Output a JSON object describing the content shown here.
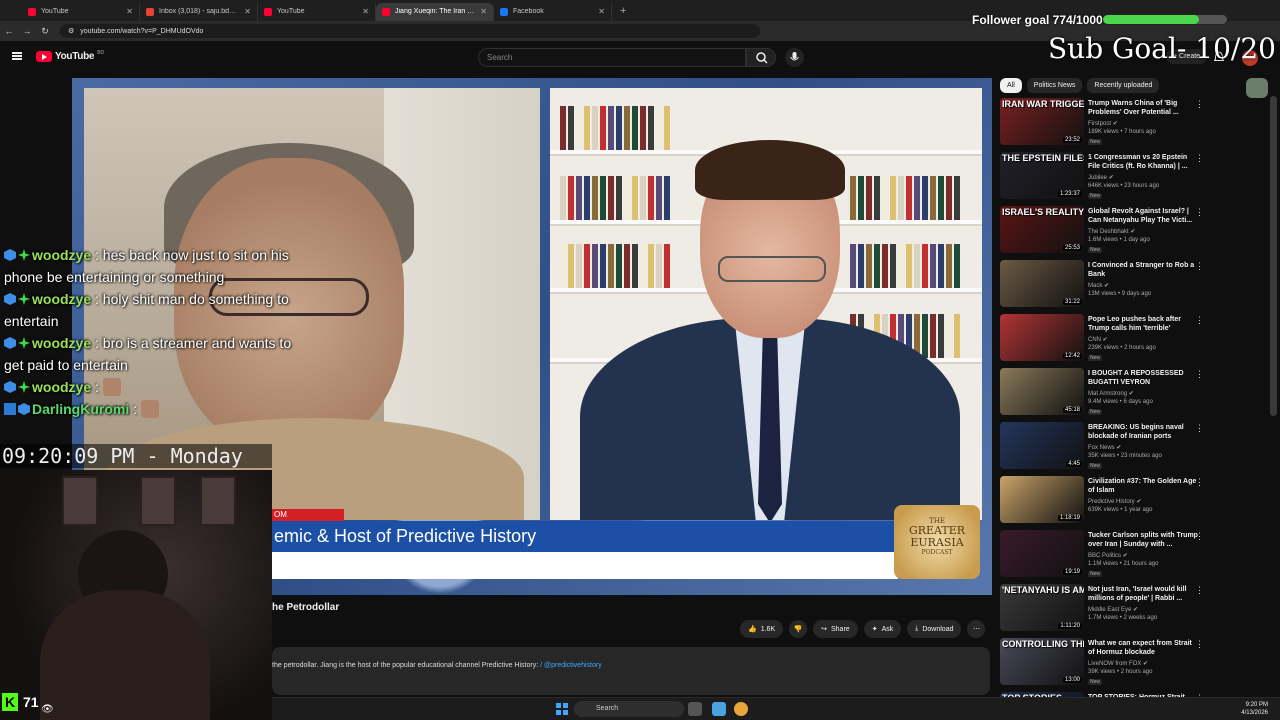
{
  "browser": {
    "tabs": [
      {
        "title": "YouTube",
        "color": "#ff0033"
      },
      {
        "title": "Inbox (3,018) - saju.bd113@gm",
        "color": "#ea4335"
      },
      {
        "title": "YouTube",
        "color": "#ff0033"
      },
      {
        "title": "Jiang Xueqin: The Iran War",
        "color": "#ff0033",
        "active": true
      },
      {
        "title": "Facebook",
        "color": "#1877f2"
      }
    ],
    "url": "youtube.com/watch?v=P_DHMUdOVdo"
  },
  "youtube": {
    "logo_text": "YouTube",
    "country_code": "BD",
    "search_placeholder": "Search",
    "create_label": "Create"
  },
  "overlay": {
    "follower_goal": "Follower goal 774/1000",
    "follower_progress": 0.774,
    "sub_goal": "Sub Goal- 10/20",
    "clock": "09:20:09 PM - Monday",
    "viewer_count": "71",
    "kick_logo": "K"
  },
  "chat": [
    {
      "user": "woodzye",
      "text": ": hes back now just to sit on his phone be entertaining or something"
    },
    {
      "user": "woodzye",
      "text": ": holy shit man do something to entertain"
    },
    {
      "user": "woodzye",
      "text": ": bro is a streamer and wants to get paid to entertain"
    },
    {
      "user": "woodzye",
      "text": ":"
    },
    {
      "user": "DarlingKuromi",
      "text": ":"
    }
  ],
  "video": {
    "lower_third": "emic & Host of Predictive History",
    "lower_third_tag": "OM",
    "podcast_logo": {
      "line1": "THE",
      "line2": "GREATER EURASIA",
      "line3": "PODCAST"
    },
    "title": "he Petrodollar",
    "description": "the petrodollar. Jiang is the host of the popular educational channel Predictive History:",
    "description_handle": "/ @predictivehistory",
    "actions": {
      "likes": "1.6K",
      "share": "Share",
      "ask": "Ask",
      "download": "Download"
    }
  },
  "sidebar": {
    "chips": [
      "All",
      "Politics News",
      "Recently uploaded"
    ],
    "items": [
      {
        "title": "Trump Warns China of 'Big Problems' Over Potential ...",
        "channel": "Firstpost",
        "meta": "189K views • 7 hours ago",
        "new": "New",
        "duration": "23:52",
        "caption": "IRAN WAR TRIGGERS",
        "color": "#7a2020"
      },
      {
        "title": "1 Congressman vs 20 Epstein File Critics (ft. Ro Khanna) | ...",
        "channel": "Jubilee",
        "meta": "646K views • 23 hours ago",
        "new": "New",
        "duration": "1:23:37",
        "caption": "THE EPSTEIN FILES",
        "color": "#20202a"
      },
      {
        "title": "Global Revolt Against Israel? | Can Netanyahu Play The Victi...",
        "channel": "The Deshbhakt",
        "meta": "1.6M views • 1 day ago",
        "new": "New",
        "duration": "25:53",
        "caption": "ISRAEL'S REALITY",
        "color": "#5a1414"
      },
      {
        "title": "I Convinced a Stranger to Rob a Bank",
        "channel": "Mack",
        "meta": "13M views • 9 days ago",
        "new": "",
        "duration": "31:22",
        "caption": "",
        "color": "#6b5a44"
      },
      {
        "title": "Pope Leo pushes back after Trump calls him 'terrible'",
        "channel": "CNN",
        "meta": "239K views • 2 hours ago",
        "new": "New",
        "duration": "12:42",
        "caption": "",
        "color": "#b33434"
      },
      {
        "title": "I BOUGHT A REPOSSESSED BUGATTI VEYRON",
        "channel": "Mat Armstrong",
        "meta": "9.4M views • 6 days ago",
        "new": "New",
        "duration": "45:18",
        "caption": "",
        "color": "#8a7a5a"
      },
      {
        "title": "BREAKING: US begins naval blockade of Iranian ports",
        "channel": "Fox News",
        "meta": "35K views • 23 minutes ago",
        "new": "New",
        "duration": "4:45",
        "caption": "",
        "color": "#23365e"
      },
      {
        "title": "Civilization #37: The Golden Age of Islam",
        "channel": "Predictive History",
        "meta": "639K views • 1 year ago",
        "new": "",
        "duration": "1:18:19",
        "caption": "",
        "color": "#caa46a"
      },
      {
        "title": "Tucker Carlson splits with Trump over Iran | Sunday with ...",
        "channel": "BBC Politics",
        "meta": "1.1M views • 21 hours ago",
        "new": "New",
        "duration": "19:19",
        "caption": "",
        "color": "#3a1a2a"
      },
      {
        "title": "Not just Iran, 'Israel would kill millions of people' | Rabbi ...",
        "channel": "Middle East Eye",
        "meta": "1.7M views • 2 weeks ago",
        "new": "",
        "duration": "1:11:20",
        "caption": "'NETANYAHU IS AMALEK'",
        "color": "#3a3a3a"
      },
      {
        "title": "What we can expect from Strait of Hormuz blockade",
        "channel": "LiveNOW from FOX",
        "meta": "39K views • 2 hours ago",
        "new": "New",
        "duration": "13:00",
        "caption": "CONTROLLING THE STRAIT",
        "color": "#4a4a5a"
      },
      {
        "title": "TOP STORIES: Hormuz Strait",
        "channel": "",
        "meta": "",
        "new": "",
        "duration": "",
        "caption": "TOP STORIES",
        "color": "#1a2a4a"
      }
    ]
  },
  "taskbar": {
    "search": "Search",
    "time": "9:20 PM",
    "date": "4/13/2026"
  }
}
